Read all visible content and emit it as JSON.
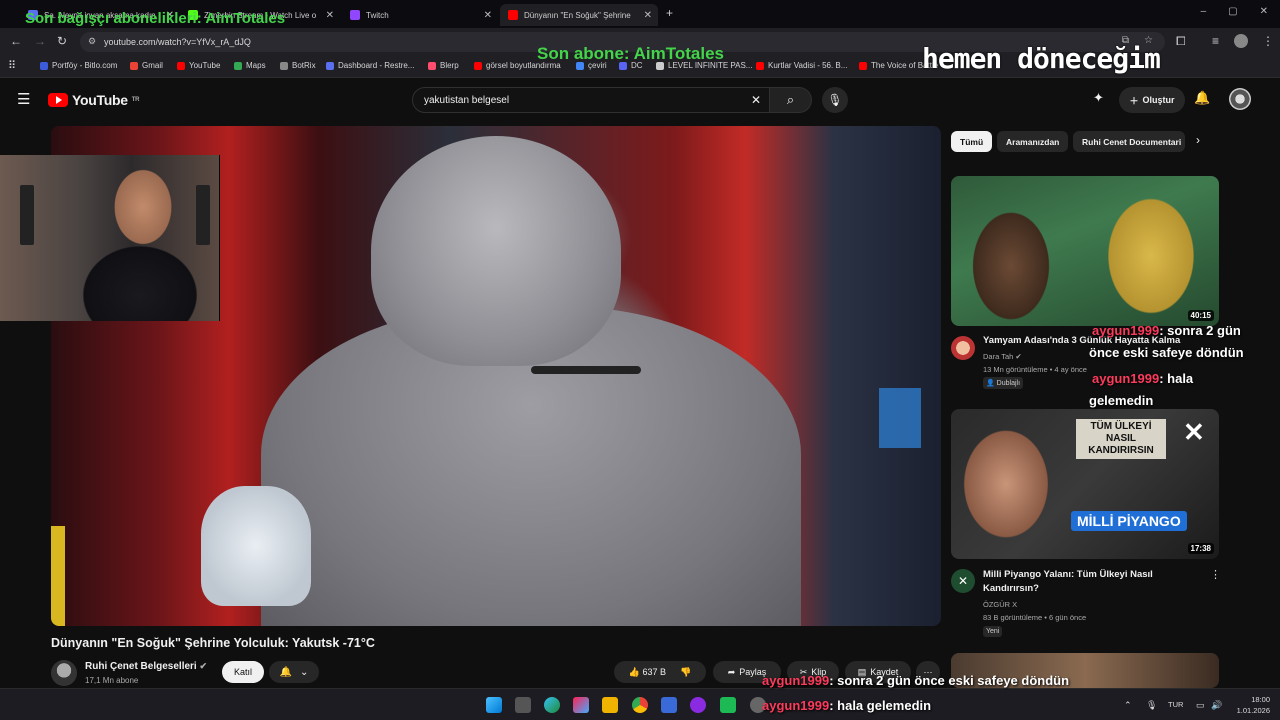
{
  "browser": {
    "tabs": [
      {
        "title": "Sa. Aleyna inyan akşama kadın",
        "color": "#5a6ef0"
      },
      {
        "title": "Zimerbin Stream - Watch Live o",
        "color": "#53fc18"
      },
      {
        "title": "Twitch",
        "color": "#9146ff"
      },
      {
        "title": "Dünyanın \"En Soğuk\" Şehrine",
        "color": "#ff0000"
      }
    ],
    "new_tab": "+",
    "url": "youtube.com/watch?v=YfVx_rA_dJQ",
    "bookmarks": [
      {
        "label": "Portföy - Bitlo.com",
        "color": "#3b5bdb"
      },
      {
        "label": "Gmail",
        "color": "#ea4335"
      },
      {
        "label": "YouTube",
        "color": "#ff0000"
      },
      {
        "label": "Maps",
        "color": "#34a853"
      },
      {
        "label": "BotRix",
        "color": "#888888"
      },
      {
        "label": "Dashboard - Restre...",
        "color": "#5a6ef0"
      },
      {
        "label": "Blerp",
        "color": "#ff4d6d"
      },
      {
        "label": "görsel boyutlandırma",
        "color": "#ff0000"
      },
      {
        "label": "çeviri",
        "color": "#4285f4"
      },
      {
        "label": "DC",
        "color": "#5865f2"
      },
      {
        "label": "LEVEL INFINITE PAS...",
        "color": "#cccccc"
      },
      {
        "label": "Kurtlar Vadisi - 56. B...",
        "color": "#ff0000"
      },
      {
        "label": "The Voice of Battle",
        "color": "#ff0000"
      }
    ]
  },
  "youtube": {
    "logo": "YouTube",
    "logo_sup": "TR",
    "search_value": "yakutistan belgesel",
    "create_label": "Oluştur",
    "video_title": "Dünyanın \"En Soğuk\" Şehrine Yolculuk: Yakutsk -71°C",
    "channel_name": "Ruhi Çenet Belgeselleri",
    "channel_subs": "17,1 Mn abone",
    "join_label": "Katıl",
    "likes": "637 B",
    "share_label": "Paylaş",
    "clip_label": "Klip",
    "save_label": "Kaydet",
    "chips": [
      "Tümü",
      "Aramanızdan",
      "Ruhi Cenet Documentari"
    ],
    "related": [
      {
        "title": "Yamyam Adası'nda 3 Günlük Hayatta Kalma",
        "channel": "Dara Tah",
        "meta": "13 Mn görüntüleme • 4 ay önce",
        "badge": "Dublajlı",
        "duration": "40:15"
      },
      {
        "title": "Milli Piyango Yalanı: Tüm Ülkeyi Nasıl Kandırırsın?",
        "channel": "ÖZGÜR X",
        "meta": "83 B görüntüleme • 6 gün önce",
        "badge": "Yeni",
        "duration": "17:38",
        "thumb_text_top": "TÜM ÜLKEYİ NASIL KANDIRIRSIN",
        "thumb_text_logo": "MİLLİ PİYANGO"
      }
    ]
  },
  "overlays": {
    "sub_top": "Son bağışçı abonelikleri: AimTotales",
    "sub_mid": "Son abone: AimTotales",
    "right_banner": "hemen döneceğim",
    "chat": [
      {
        "user": "aygun1999",
        "text": ": sonra 2 gün",
        "text2": "önce eski safeye döndün"
      },
      {
        "user": "aygun1999",
        "text": ": hala",
        "text2": "gelemedin"
      },
      {
        "user": "aygun1999",
        "text": ": sonra 2 gün önce eski safeye döndün"
      },
      {
        "user": "aygun1999",
        "text": ": hala gelemedin"
      }
    ]
  },
  "taskbar": {
    "lang": "TUR",
    "time": "18:00",
    "date": "1.01.2026"
  }
}
